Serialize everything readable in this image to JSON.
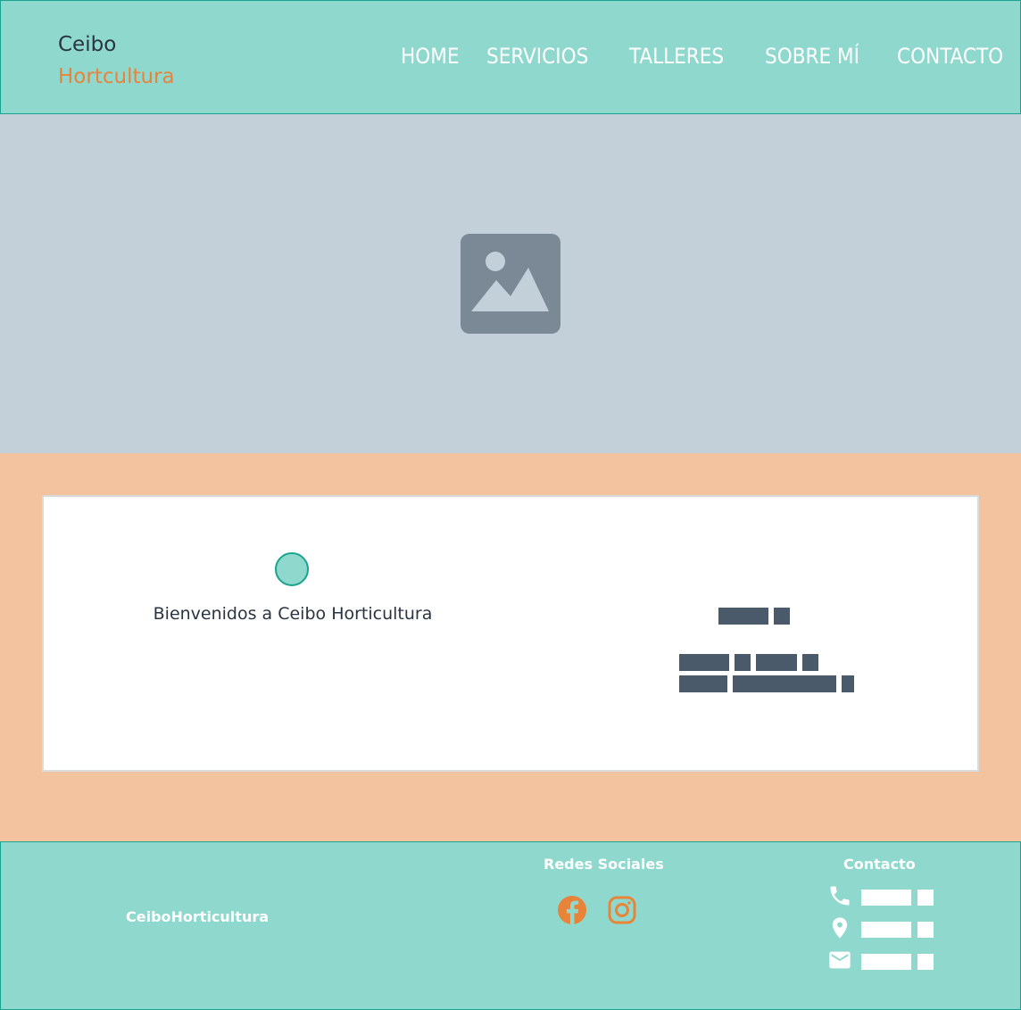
{
  "header": {
    "logo_line1": "Ceibo",
    "logo_line2": "Hortcultura",
    "nav": [
      "HOME",
      "SERVICIOS",
      "TALLERES",
      "SOBRE MÍ",
      "CONTACTO"
    ]
  },
  "hero": {
    "icon": "image-placeholder-icon"
  },
  "main": {
    "welcome": "Bienvenidos a Ceibo Horticultura"
  },
  "footer": {
    "brand": "CeiboHorticultura",
    "social_title": "Redes Sociales",
    "social_icons": [
      "facebook-icon",
      "instagram-icon"
    ],
    "contact_title": "Contacto",
    "contact_icons": [
      "phone-icon",
      "location-icon",
      "mail-icon"
    ]
  },
  "colors": {
    "teal": "#8fd8ce",
    "teal_border": "#1aa48f",
    "orange": "#e8843a",
    "peach": "#f3c29f",
    "hero_bg": "#c3d0d9",
    "placeholder": "#7b8896",
    "dark_text": "#2a3440"
  }
}
